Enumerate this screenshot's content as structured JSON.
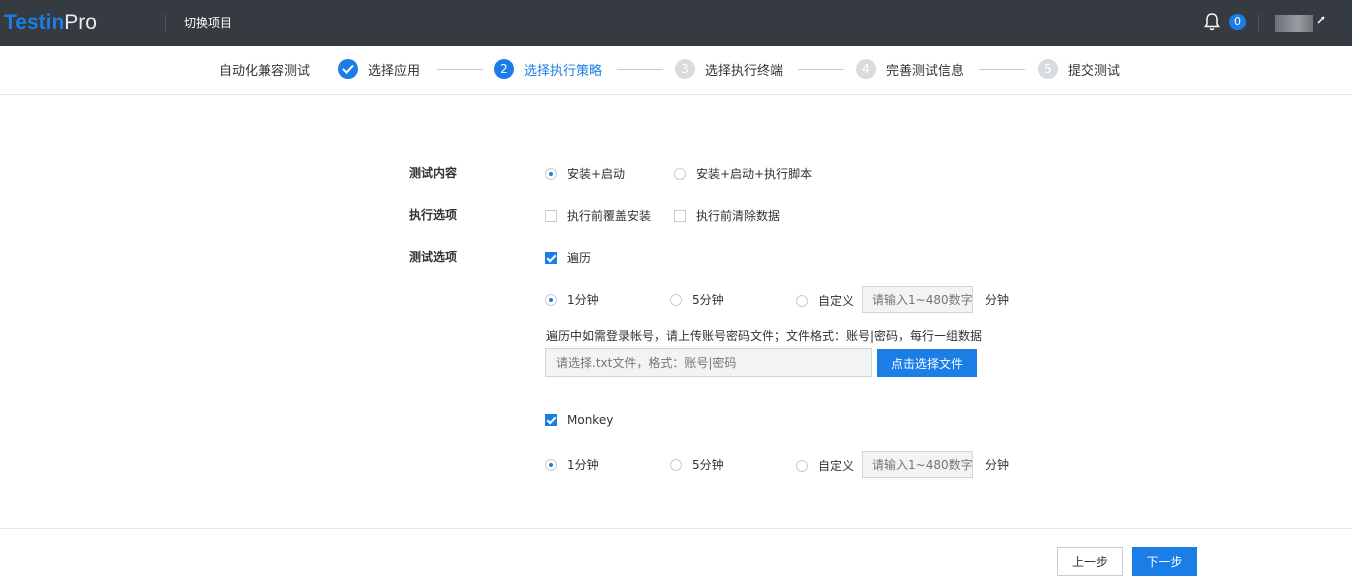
{
  "header": {
    "logo_part1": "Testin",
    "logo_part2": "Pro",
    "switch_project": "切换项目",
    "notification_count": "0",
    "bell_icon": "bell-icon",
    "accent_color": "#1a7ee6"
  },
  "steps": {
    "root": "自动化兼容测试",
    "items": [
      {
        "num": "",
        "label": "选择应用",
        "state": "done"
      },
      {
        "num": "2",
        "label": "选择执行策略",
        "state": "active"
      },
      {
        "num": "3",
        "label": "选择执行终端",
        "state": "todo"
      },
      {
        "num": "4",
        "label": "完善测试信息",
        "state": "todo"
      },
      {
        "num": "5",
        "label": "提交测试",
        "state": "todo"
      }
    ]
  },
  "form": {
    "test_content": {
      "label": "测试内容",
      "options": [
        "安装+启动",
        "安装+启动+执行脚本"
      ],
      "selected": 0
    },
    "exec_options": {
      "label": "执行选项",
      "options": [
        "执行前覆盖安装",
        "执行前清除数据"
      ]
    },
    "test_options": {
      "label": "测试选项",
      "traverse": {
        "label": "遍历",
        "checked": true,
        "durations": [
          "1分钟",
          "5分钟",
          "自定义"
        ],
        "selected": 0,
        "custom_placeholder": "请输入1~480数字",
        "unit": "分钟",
        "hint": "遍历中如需登录帐号，请上传账号密码文件；文件格式：账号|密码，每行一组数据",
        "file_placeholder": "请选择.txt文件，格式：账号|密码",
        "file_button": "点击选择文件"
      },
      "monkey": {
        "label": "Monkey",
        "checked": true,
        "durations": [
          "1分钟",
          "5分钟",
          "自定义"
        ],
        "selected": 0,
        "custom_placeholder": "请输入1~480数字",
        "unit": "分钟"
      }
    }
  },
  "footer": {
    "prev": "上一步",
    "next": "下一步"
  }
}
